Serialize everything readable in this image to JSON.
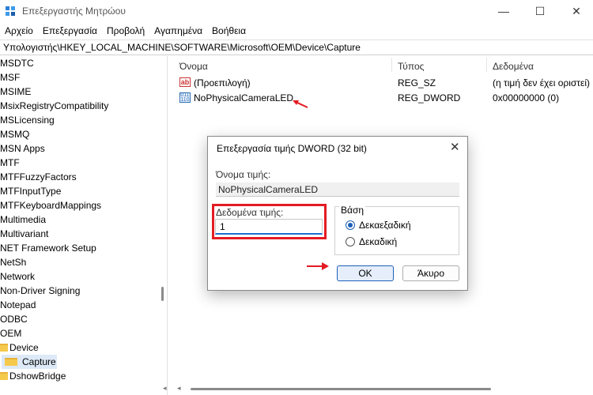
{
  "window": {
    "title": "Επεξεργαστής Μητρώου",
    "minimize": "—",
    "maximize": "☐",
    "close": "✕"
  },
  "menu": [
    "Αρχείο",
    "Επεξεργασία",
    "Προβολή",
    "Αγαπημένα",
    "Βοήθεια"
  ],
  "address": "Υπολογιστής\\HKEY_LOCAL_MACHINE\\SOFTWARE\\Microsoft\\OEM\\Device\\Capture",
  "tree": {
    "items": [
      {
        "label": "MSDTC"
      },
      {
        "label": "MSF"
      },
      {
        "label": "MSIME"
      },
      {
        "label": "MsixRegistryCompatibility"
      },
      {
        "label": "MSLicensing"
      },
      {
        "label": "MSMQ"
      },
      {
        "label": "MSN Apps"
      },
      {
        "label": "MTF"
      },
      {
        "label": "MTFFuzzyFactors"
      },
      {
        "label": "MTFInputType"
      },
      {
        "label": "MTFKeyboardMappings"
      },
      {
        "label": "Multimedia"
      },
      {
        "label": "Multivariant"
      },
      {
        "label": "NET Framework Setup"
      },
      {
        "label": "NetSh"
      },
      {
        "label": "Network"
      },
      {
        "label": "Non-Driver Signing"
      },
      {
        "label": "Notepad"
      },
      {
        "label": "ODBC"
      },
      {
        "label": "OEM"
      },
      {
        "label": "Device"
      },
      {
        "label": "Capture"
      },
      {
        "label": "DshowBridge"
      }
    ]
  },
  "list": {
    "columns": [
      "Όνομα",
      "Τύπος",
      "Δεδομένα"
    ],
    "rows": [
      {
        "name": "(Προεπιλογή)",
        "type": "REG_SZ",
        "data": "(η τιμή δεν έχει οριστεί)",
        "icon": "ab-string-icon"
      },
      {
        "name": "NoPhysicalCameraLED",
        "type": "REG_DWORD",
        "data": "0x00000000 (0)",
        "icon": "binary-value-icon"
      }
    ]
  },
  "dialog": {
    "title": "Επεξεργασία τιμής DWORD (32 bit)",
    "close": "✕",
    "name_label": "Όνομα τιμής:",
    "name_value": "NoPhysicalCameraLED",
    "data_label": "Δεδομένα τιμής:",
    "data_value": "1",
    "basis_label": "Βάση",
    "hex_label": "Δεκαεξαδική",
    "dec_label": "Δεκαδική",
    "ok_label": "OK",
    "cancel_label": "Άκυρο"
  },
  "colors": {
    "highlight": "#e41b23",
    "accent": "#1c5fb8"
  }
}
